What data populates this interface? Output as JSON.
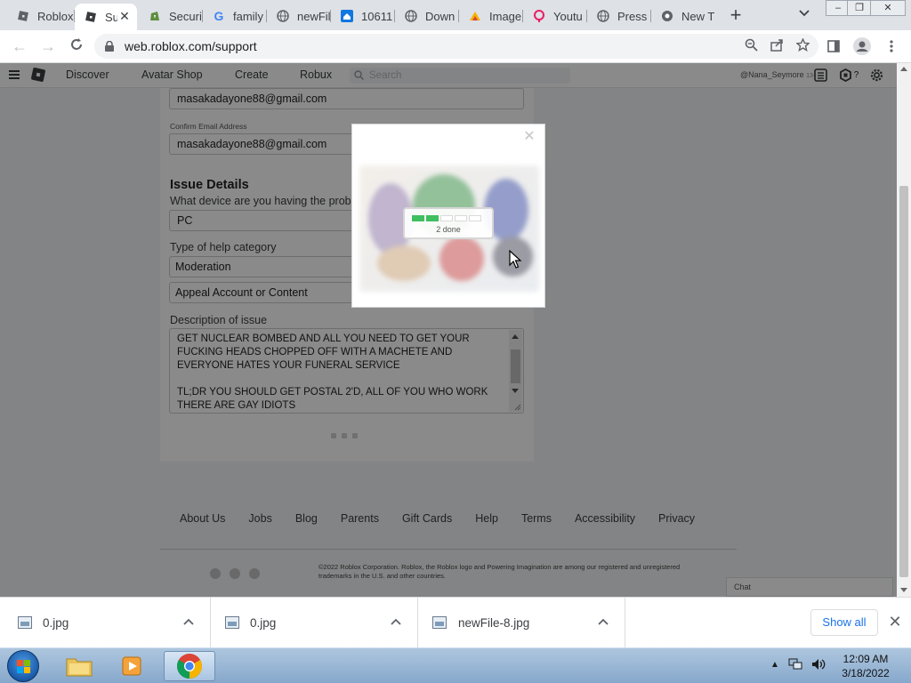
{
  "browser": {
    "tabs": [
      {
        "title": "Roblox",
        "icon": "roblox-icon"
      },
      {
        "title": "Support",
        "icon": "roblox-icon",
        "active": true
      },
      {
        "title": "Security",
        "icon": "shopify-icon"
      },
      {
        "title": "family",
        "icon": "google-icon"
      },
      {
        "title": "newFile",
        "icon": "globe-icon"
      },
      {
        "title": "10611",
        "icon": "zillow-icon"
      },
      {
        "title": "Down",
        "icon": "globe-icon"
      },
      {
        "title": "Image",
        "icon": "image-icon"
      },
      {
        "title": "Youtu",
        "icon": "pin-icon"
      },
      {
        "title": "Press",
        "icon": "globe-icon"
      },
      {
        "title": "New T",
        "icon": "chrome-icon"
      }
    ],
    "url": "web.roblox.com/support",
    "colors": {
      "tabstrip": "#dee1e6",
      "accent": "#1a73e8"
    }
  },
  "roblox_nav": {
    "items": [
      "Discover",
      "Avatar Shop",
      "Create",
      "Robux"
    ],
    "search_placeholder": "Search",
    "username": "@Nana_Seymore",
    "age_badge": "13+",
    "robux_count": "?"
  },
  "form": {
    "email_value": "masakadayone88@gmail.com",
    "confirm_email_label": "Confirm Email Address",
    "confirm_email_value": "masakadayone88@gmail.com",
    "issue_heading": "Issue Details",
    "device_question": "What device are you having the problem on?",
    "device_value": "PC",
    "help_category_label": "Type of help category",
    "help_category_value": "Moderation",
    "subcategory_value": "Appeal Account or Content",
    "description_label": "Description of issue",
    "description_value": "GET NUCLEAR BOMBED AND ALL YOU NEED TO GET YOUR FUCKING HEADS CHOPPED OFF WITH A MACHETE AND EVERYONE HATES YOUR FUNERAL SERVICE\n\nTL;DR YOU SHOULD GET POSTAL 2'D, ALL OF YOU WHO WORK THERE ARE GAY IDIOTS"
  },
  "footer": {
    "links": [
      "About Us",
      "Jobs",
      "Blog",
      "Parents",
      "Gift Cards",
      "Help",
      "Terms",
      "Accessibility",
      "Privacy"
    ],
    "copyright": "©2022 Roblox Corporation. Roblox, the Roblox logo and Powering Imagination are among our registered and unregistered trademarks in the U.S. and other countries.",
    "chat_label": "Chat"
  },
  "modal": {
    "progress_text": "2 done",
    "segments_total": 5,
    "segments_done": 2,
    "progress_color": "#3fbf5f"
  },
  "downloads": {
    "items": [
      {
        "name": "0.jpg"
      },
      {
        "name": "0.jpg"
      },
      {
        "name": "newFile-8.jpg"
      }
    ],
    "show_all_label": "Show all"
  },
  "taskbar": {
    "time": "12:09 AM",
    "date": "3/18/2022"
  }
}
